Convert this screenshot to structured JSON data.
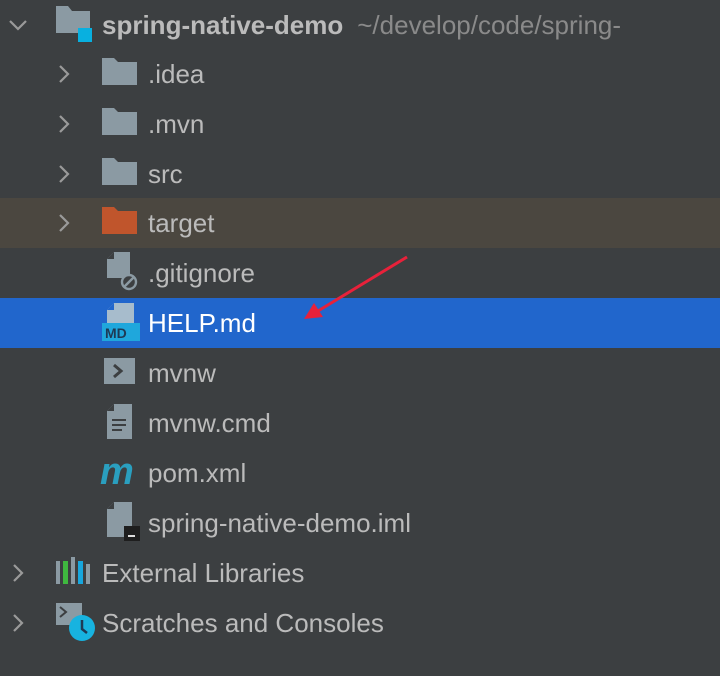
{
  "tree": {
    "root": {
      "name": "spring-native-demo",
      "path": "~/develop/code/spring-"
    },
    "children": [
      {
        "name": ".idea",
        "icon": "folder-icon"
      },
      {
        "name": ".mvn",
        "icon": "folder-icon"
      },
      {
        "name": "src",
        "icon": "folder-icon"
      },
      {
        "name": "target",
        "icon": "excluded-folder-icon"
      },
      {
        "name": ".gitignore",
        "icon": "ignore-file-icon"
      },
      {
        "name": "HELP.md",
        "icon": "markdown-file-icon"
      },
      {
        "name": "mvnw",
        "icon": "shell-script-icon"
      },
      {
        "name": "mvnw.cmd",
        "icon": "text-file-icon"
      },
      {
        "name": "pom.xml",
        "icon": "maven-icon"
      },
      {
        "name": "spring-native-demo.iml",
        "icon": "module-file-icon"
      }
    ],
    "external_libraries": "External Libraries",
    "scratches": "Scratches and Consoles"
  },
  "colors": {
    "background": "#3c3f41",
    "selection": "#2166cc",
    "excluded": "#4b4740",
    "annotation_arrow": "#e8213a"
  }
}
